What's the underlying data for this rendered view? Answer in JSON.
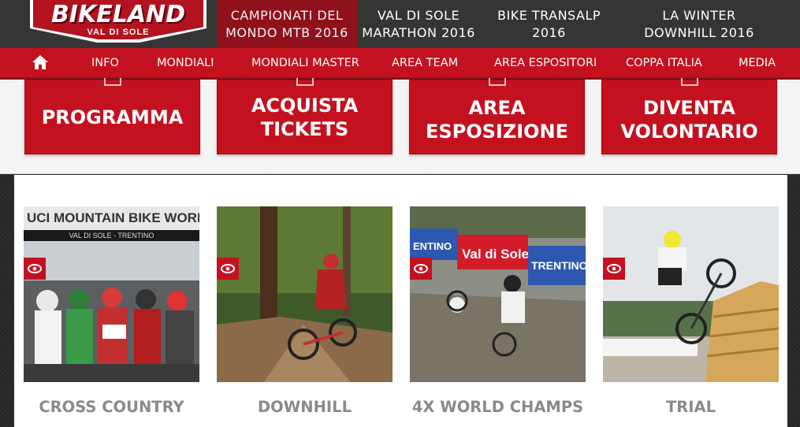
{
  "logo": {
    "title": "BIKELAND",
    "subtitle": "VAL DI SOLE"
  },
  "top_nav": [
    {
      "line1": "CAMPIONATI DEL",
      "line2": "MONDO MTB 2016"
    },
    {
      "line1": "VAL DI SOLE",
      "line2": "MARATHON 2016"
    },
    {
      "line1": "BIKE TRANSALP",
      "line2": "2016"
    },
    {
      "line1": "LA WINTER",
      "line2": "DOWNHILL 2016"
    }
  ],
  "main_nav": {
    "home_icon": "home-icon",
    "items": [
      "INFO",
      "MONDIALI",
      "MONDIALI MASTER",
      "AREA TEAM",
      "AREA ESPOSITORI",
      "COPPA ITALIA",
      "MEDIA"
    ]
  },
  "tiles": [
    {
      "line1": "PROGRAMMA",
      "line2": ""
    },
    {
      "line1": "ACQUISTA",
      "line2": "TICKETS"
    },
    {
      "line1": "AREA",
      "line2": "ESPOSIZIONE"
    },
    {
      "line1": "DIVENTA",
      "line2": "VOLONTARIO"
    }
  ],
  "cards": [
    {
      "title": "CROSS COUNTRY",
      "banner": "UCI MOUNTAIN BIKE WORLD C",
      "banner_sub": "VAL DI SOLE - TRENTINO"
    },
    {
      "title": "DOWNHILL"
    },
    {
      "title": "4X WORLD CHAMPS",
      "sign1": "Val di Sole",
      "sign2": "ENTINO",
      "sign3": "TRENTINO"
    },
    {
      "title": "TRIAL"
    }
  ],
  "colors": {
    "brand_red": "#c4111f",
    "dark": "#353535",
    "active": "#8f111b"
  }
}
